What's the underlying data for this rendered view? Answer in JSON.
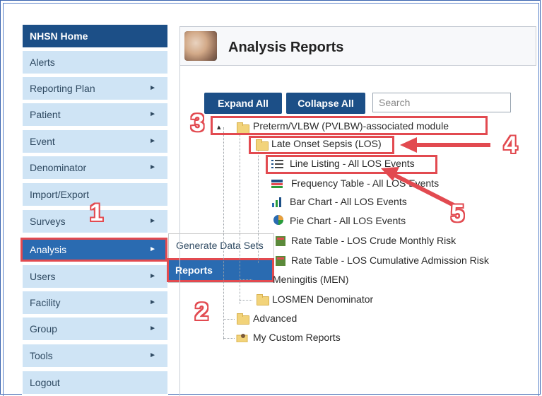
{
  "sidebar": {
    "items": [
      {
        "label": "NHSN Home",
        "arrow": ""
      },
      {
        "label": "Alerts",
        "arrow": ""
      },
      {
        "label": "Reporting Plan",
        "arrow": "►"
      },
      {
        "label": "Patient",
        "arrow": "►"
      },
      {
        "label": "Event",
        "arrow": "►"
      },
      {
        "label": "Denominator",
        "arrow": "►"
      },
      {
        "label": "Import/Export",
        "arrow": ""
      },
      {
        "label": "Surveys",
        "arrow": "►"
      },
      {
        "label": "Analysis",
        "arrow": "►"
      },
      {
        "label": "Users",
        "arrow": "►"
      },
      {
        "label": "Facility",
        "arrow": "►"
      },
      {
        "label": "Group",
        "arrow": "►"
      },
      {
        "label": "Tools",
        "arrow": "►"
      },
      {
        "label": "Logout",
        "arrow": ""
      }
    ]
  },
  "flyout": {
    "generate": "Generate Data Sets",
    "reports": "Reports"
  },
  "header": {
    "title": "Analysis Reports"
  },
  "toolbar": {
    "expand_label": "Expand All",
    "collapse_label": "Collapse All",
    "search_placeholder": "Search"
  },
  "tree": {
    "module": "Preterm/VLBW (PVLBW)-associated module",
    "los": "Late Onset Sepsis (LOS)",
    "line_listing": "Line Listing - All LOS Events",
    "frequency": "Frequency Table - All LOS Events",
    "bar": "Bar Chart - All LOS Events",
    "pie": "Pie Chart - All LOS Events",
    "rate_crude": "Rate Table - LOS Crude Monthly Risk",
    "rate_cumulative": "Rate Table - LOS Cumulative Admission Risk",
    "men": "Meningitis (MEN)",
    "losmen": "LOSMEN Denominator",
    "advanced": "Advanced",
    "custom": "My Custom Reports"
  },
  "callouts": {
    "n1": "1",
    "n2": "2",
    "n3": "3",
    "n4": "4",
    "n5": "5"
  },
  "colors": {
    "accent": "#e24a50",
    "nav_dark": "#1c4f87",
    "nav_active": "#2a6bb1",
    "nav_light": "#cfe4f5"
  }
}
